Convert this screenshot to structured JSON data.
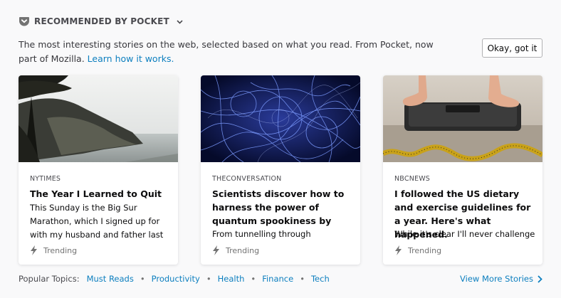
{
  "section": {
    "title": "RECOMMENDED BY POCKET",
    "icon": "pocket-icon",
    "menu_icon": "chevron-down-icon"
  },
  "intro": {
    "text": "The most interesting stories on the web, selected based on what you read. From Pocket, now part of Mozilla.",
    "link": "Learn how it works."
  },
  "dismiss_button": "Okay, got it",
  "cards": [
    {
      "source": "NYTIMES",
      "title": "The Year I Learned to Quit",
      "excerpt": "This Sunday is the Big Sur Marathon, which I signed up for with my husband and father last",
      "context": "Trending",
      "image": "coastal-cliff-photo"
    },
    {
      "source": "THECONVERSATION",
      "title": "Scientists discover how to harness the power of quantum spookiness by",
      "excerpt": "From tunnelling through",
      "context": "Trending",
      "image": "quantum-filaments-photo"
    },
    {
      "source": "NBCNEWS",
      "title": "I followed the US dietary and exercise guidelines for a year. Here's what happened.",
      "excerpt": "While it's clear I'll never challenge",
      "context": "Trending",
      "image": "bathroom-scale-photo"
    }
  ],
  "footer": {
    "topics_label": "Popular Topics:",
    "topics": [
      "Must Reads",
      "Productivity",
      "Health",
      "Finance",
      "Tech"
    ],
    "view_more": "View More Stories"
  },
  "colors": {
    "background": "#f9f9fa",
    "link": "#0d7fbf",
    "muted": "#737373"
  }
}
